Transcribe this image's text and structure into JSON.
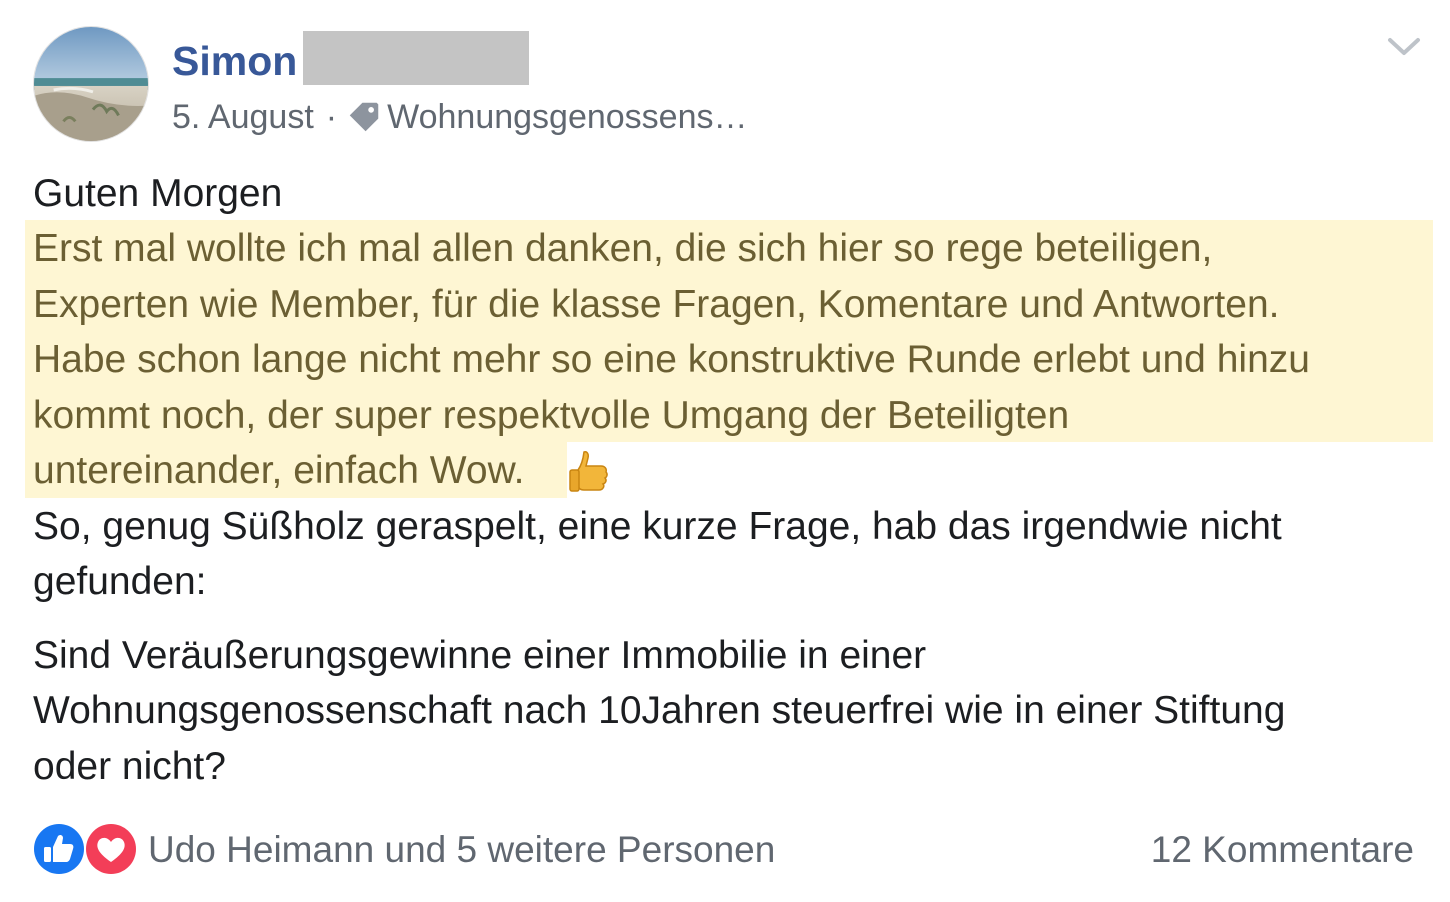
{
  "post": {
    "author_name": "Simon",
    "date": "5. August",
    "separator": "·",
    "group_name": "Wohnungsgenossens…",
    "icons": {
      "avatar": "avatar-beach-photo",
      "tag": "tag-icon",
      "menu": "chevron-down-icon",
      "emoji": "thumbs-up-emoji",
      "like": "like-reaction-icon",
      "love": "love-reaction-icon"
    },
    "body": {
      "greeting": "Guten Morgen",
      "highlight_lines": [
        "Erst mal wollte ich mal allen danken, die sich hier so rege beteiligen,",
        "Experten wie Member, für die klasse Fragen, Komentare und Antworten.",
        "Habe schon lange nicht mehr so eine konstruktive Runde erlebt und hinzu",
        "kommt noch, der super respektvolle Umgang der Beteiligten",
        "untereinander, einfach Wow."
      ],
      "lines_after": [
        "So, genug Süßholz geraspelt, eine kurze Frage, hab das irgendwie nicht",
        "gefunden:"
      ],
      "question_lines": [
        "Sind Veräußerungsgewinne einer Immobilie in einer",
        "Wohnungsgenossenschaft nach 10Jahren steuerfrei wie in einer Stiftung",
        "oder nicht?"
      ]
    },
    "footer": {
      "reactions_text": "Udo Heimann und 5 weitere Personen",
      "comments_text": "12 Kommentare"
    },
    "colors": {
      "name": "#385898",
      "meta": "#606770",
      "highlight_bg": "#fef6d3",
      "highlight_text": "#6b5f33",
      "like_blue": "#1877f2",
      "love_red": "#f33e58"
    }
  }
}
